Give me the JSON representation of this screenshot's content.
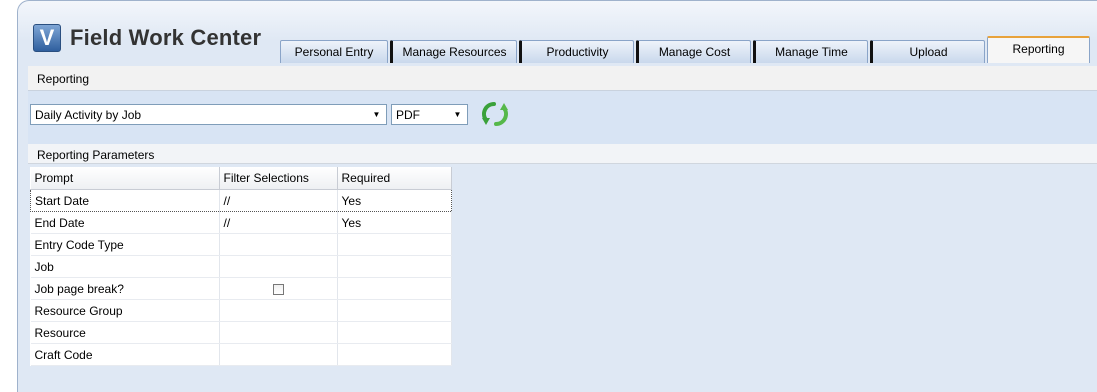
{
  "app": {
    "title": "Field Work Center",
    "logo_letter": "V"
  },
  "tabs": [
    {
      "label": "Personal Entry",
      "active": false
    },
    {
      "label": "Manage Resources",
      "active": false
    },
    {
      "label": "Productivity",
      "active": false
    },
    {
      "label": "Manage Cost",
      "active": false
    },
    {
      "label": "Manage Time",
      "active": false
    },
    {
      "label": "Upload",
      "active": false
    },
    {
      "label": "Reporting",
      "active": true
    }
  ],
  "section": {
    "title": "Reporting"
  },
  "toolbar": {
    "report_value": "Daily Activity by Job",
    "format_value": "PDF",
    "refresh_icon": "refresh-icon"
  },
  "parameters": {
    "title": "Reporting Parameters",
    "columns": [
      "Prompt",
      "Filter Selections",
      "Required"
    ],
    "rows": [
      {
        "prompt": "Start Date",
        "filter": "//",
        "required": "Yes",
        "checkbox": false,
        "selected": true
      },
      {
        "prompt": "End Date",
        "filter": "//",
        "required": "Yes",
        "checkbox": false,
        "selected": false
      },
      {
        "prompt": "Entry Code Type",
        "filter": "",
        "required": "",
        "checkbox": false,
        "selected": false
      },
      {
        "prompt": "Job",
        "filter": "",
        "required": "",
        "checkbox": false,
        "selected": false
      },
      {
        "prompt": "Job page break?",
        "filter": "",
        "required": "",
        "checkbox": true,
        "selected": false
      },
      {
        "prompt": "Resource Group",
        "filter": "",
        "required": "",
        "checkbox": false,
        "selected": false
      },
      {
        "prompt": "Resource",
        "filter": "",
        "required": "",
        "checkbox": false,
        "selected": false
      },
      {
        "prompt": "Craft Code",
        "filter": "",
        "required": "",
        "checkbox": false,
        "selected": false
      }
    ]
  },
  "colors": {
    "accent_tab_top": "#e8a23b",
    "toolbar_bg": "#d8e4f4",
    "refresh_green": "#3aa13a"
  }
}
